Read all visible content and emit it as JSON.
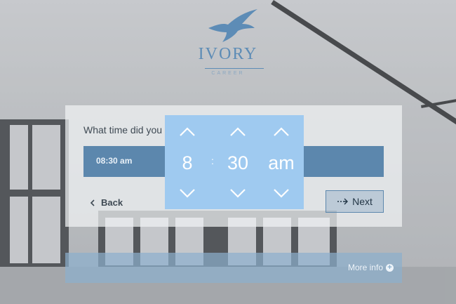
{
  "brand": {
    "name": "IVORY",
    "tagline": "CAREER"
  },
  "form": {
    "question": "What time did you",
    "time_value": "08:30 am",
    "back_label": "Back",
    "next_label": "Next"
  },
  "more_info": {
    "label": "More info"
  },
  "time_picker": {
    "hour": "8",
    "separator": ":",
    "minute": "30",
    "period": "am"
  },
  "colors": {
    "accent": "#5c87ad",
    "picker_bg": "#9fcaf0",
    "brand": "#5d8cb6"
  },
  "icons": {
    "back": "chevron-left-icon",
    "next": "dotted-arrow-right-icon",
    "more": "plus-circle-icon",
    "up": "chevron-up-icon",
    "down": "chevron-down-icon",
    "logo": "eagle-logo-icon"
  }
}
